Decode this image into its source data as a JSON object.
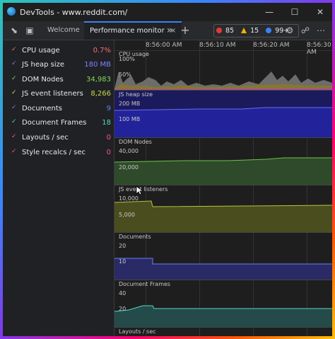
{
  "window": {
    "title": "DevTools - www.reddit.com/"
  },
  "toolbar": {
    "tabs": [
      {
        "label": "Welcome"
      },
      {
        "label": "Performance monitor",
        "close": "×"
      }
    ],
    "more": "»",
    "add": "+",
    "issues": {
      "errors": "85",
      "warnings": "15",
      "info": "99+"
    },
    "colors": {
      "errors": "#e53935",
      "warnings": "#f0b400",
      "info": "#3b82f6"
    }
  },
  "metrics": [
    {
      "label": "CPU usage",
      "value": "0.7%",
      "color": "#ff6b6b"
    },
    {
      "label": "JS heap size",
      "value": "180 MB",
      "color": "#7c83ff"
    },
    {
      "label": "DOM Nodes",
      "value": "34,983",
      "color": "#7ed957"
    },
    {
      "label": "JS event listeners",
      "value": "8,266",
      "color": "#c6d94a"
    },
    {
      "label": "Documents",
      "value": "9",
      "color": "#6d79ff"
    },
    {
      "label": "Document Frames",
      "value": "18",
      "color": "#55d6c2"
    },
    {
      "label": "Layouts / sec",
      "value": "0",
      "color": "#ff4f8b"
    },
    {
      "label": "Style recalcs / sec",
      "value": "0",
      "color": "#ff4f8b"
    }
  ],
  "time_axis": [
    "8:56:00 AM",
    "8:56:10 AM",
    "8:56:20 AM",
    "8:56:30 AM"
  ],
  "panes": [
    {
      "title": "CPU usage",
      "ticks": [
        "100%",
        "50%"
      ]
    },
    {
      "title": "JS heap size",
      "ticks": [
        "200 MB",
        "100 MB"
      ]
    },
    {
      "title": "DOM Nodes",
      "ticks": [
        "40,000",
        "20,000"
      ]
    },
    {
      "title": "JS event listeners",
      "ticks": [
        "10,000",
        "5,000"
      ]
    },
    {
      "title": "Documents",
      "ticks": [
        "20",
        "10"
      ]
    },
    {
      "title": "Document Frames",
      "ticks": [
        "40",
        "20"
      ]
    },
    {
      "title": "Layouts / sec",
      "ticks": []
    }
  ]
}
